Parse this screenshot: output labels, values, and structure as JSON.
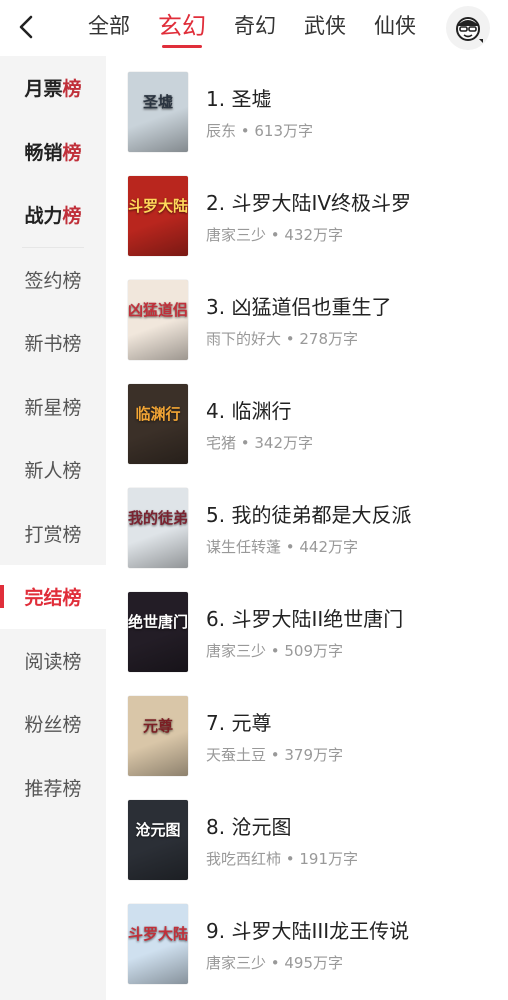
{
  "header": {
    "tabs": [
      {
        "label": "全部"
      },
      {
        "label": "玄幻"
      },
      {
        "label": "奇幻"
      },
      {
        "label": "武侠"
      },
      {
        "label": "仙侠"
      }
    ],
    "active_tab": 1
  },
  "sidebar": {
    "top_items": [
      {
        "prefix": "月票",
        "suffix": "榜"
      },
      {
        "prefix": "畅销",
        "suffix": "榜"
      },
      {
        "prefix": "战力",
        "suffix": "榜"
      }
    ],
    "items": [
      {
        "label": "签约榜"
      },
      {
        "label": "新书榜"
      },
      {
        "label": "新星榜"
      },
      {
        "label": "新人榜"
      },
      {
        "label": "打赏榜"
      },
      {
        "label": "完结榜"
      },
      {
        "label": "阅读榜"
      },
      {
        "label": "粉丝榜"
      },
      {
        "label": "推荐榜"
      }
    ],
    "active_item": 5
  },
  "books": [
    {
      "title": "1. 圣墟",
      "author": "辰东",
      "words": "613万字",
      "meta": "辰东 • 613万字",
      "cover_text": "圣墟",
      "cover_bg": "#c9d3da",
      "cover_fg": "#2a3440"
    },
    {
      "title": "2. 斗罗大陆IV终极斗罗",
      "author": "唐家三少",
      "words": "432万字",
      "meta": "唐家三少 • 432万字",
      "cover_text": "斗罗大陆",
      "cover_bg": "#b9261e",
      "cover_fg": "#ffd85a"
    },
    {
      "title": "3. 凶猛道侣也重生了",
      "author": "雨下的好大",
      "words": "278万字",
      "meta": "雨下的好大 • 278万字",
      "cover_text": "凶猛道侣",
      "cover_bg": "#f1e7dc",
      "cover_fg": "#c0303a"
    },
    {
      "title": "4. 临渊行",
      "author": "宅猪",
      "words": "342万字",
      "meta": "宅猪 • 342万字",
      "cover_text": "临渊行",
      "cover_bg": "#3b3028",
      "cover_fg": "#f2a535"
    },
    {
      "title": "5. 我的徒弟都是大反派",
      "author": "谋生任转蓬",
      "words": "442万字",
      "meta": "谋生任转蓬 • 442万字",
      "cover_text": "我的徒弟",
      "cover_bg": "#dfe4e8",
      "cover_fg": "#7a2330"
    },
    {
      "title": "6. 斗罗大陆II绝世唐门",
      "author": "唐家三少",
      "words": "509万字",
      "meta": "唐家三少 • 509万字",
      "cover_text": "绝世唐门",
      "cover_bg": "#231d26",
      "cover_fg": "#ffffff"
    },
    {
      "title": "7. 元尊",
      "author": "天蚕土豆",
      "words": "379万字",
      "meta": "天蚕土豆 • 379万字",
      "cover_text": "元尊",
      "cover_bg": "#d9c6a8",
      "cover_fg": "#7b1f24"
    },
    {
      "title": "8. 沧元图",
      "author": "我吃西红柿",
      "words": "191万字",
      "meta": "我吃西红柿 • 191万字",
      "cover_text": "沧元图",
      "cover_bg": "#2b2f36",
      "cover_fg": "#ffffff"
    },
    {
      "title": "9. 斗罗大陆III龙王传说",
      "author": "唐家三少",
      "words": "495万字",
      "meta": "唐家三少 • 495万字",
      "cover_text": "斗罗大陆",
      "cover_bg": "#cfe0ef",
      "cover_fg": "#c0303a"
    }
  ],
  "colors": {
    "accent": "#e02e3a",
    "sidebar_bg": "#f4f4f4",
    "meta_text": "#999999"
  },
  "icons": {
    "back": "chevron-left-icon",
    "avatar": "user-avatar-icon"
  }
}
